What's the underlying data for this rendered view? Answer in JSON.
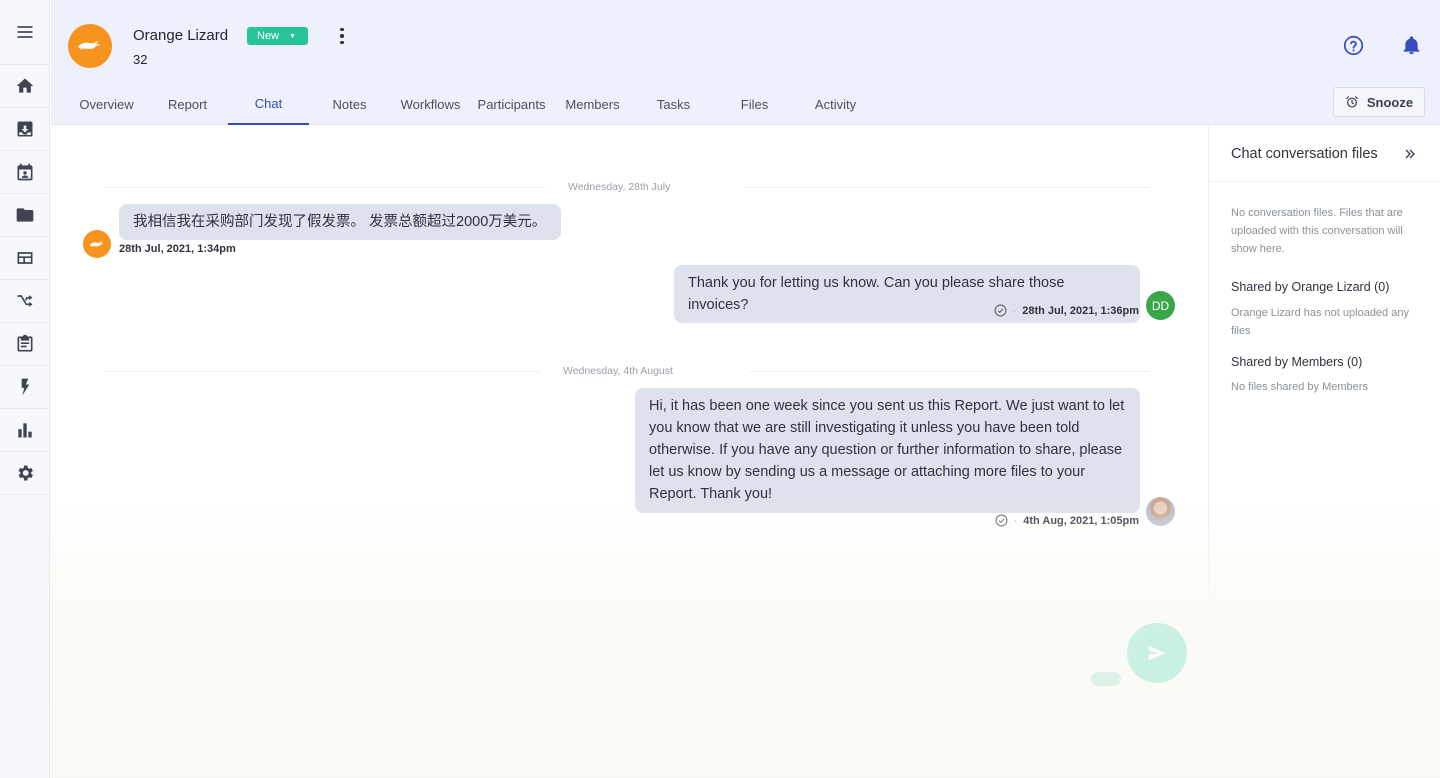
{
  "sidebar": {
    "items": [
      {
        "name": "menu-icon"
      },
      {
        "name": "home-icon"
      },
      {
        "name": "inbox-icon"
      },
      {
        "name": "calendar-icon"
      },
      {
        "name": "folder-icon"
      },
      {
        "name": "dashboard-icon"
      },
      {
        "name": "shuffle-icon"
      },
      {
        "name": "clipboard-icon"
      },
      {
        "name": "lightning-icon"
      },
      {
        "name": "bar-chart-icon"
      },
      {
        "name": "gear-icon"
      }
    ]
  },
  "header": {
    "org_name": "Orange Lizard",
    "org_number": "32",
    "status": "New",
    "snooze_label": "Snooze"
  },
  "tabs": [
    "Overview",
    "Report",
    "Chat",
    "Notes",
    "Workflows",
    "Participants",
    "Members",
    "Tasks",
    "Files",
    "Activity"
  ],
  "active_tab": "Chat",
  "chat": {
    "date1": "Wednesday, 28th July",
    "msg1": {
      "text": "我相信我在采购部门发现了假发票。 发票总额超过2000万美元。",
      "time": "28th Jul, 2021, 1:34pm"
    },
    "msg2": {
      "text": "Thank you for letting us know. Can you please share those invoices?",
      "time": "28th Jul, 2021, 1:36pm",
      "avatar": "DD"
    },
    "date2": "Wednesday, 4th August",
    "msg3": {
      "text": "Hi, it has been one week since you sent us this Report. We just want to let you know that we are still investigating it unless you have been told otherwise. If you have any question or further information to share, please let us know by sending us a message or attaching more files to your Report. Thank you!",
      "time": "4th Aug, 2021, 1:05pm"
    },
    "dot": "·"
  },
  "files_panel": {
    "title": "Chat conversation files",
    "empty_note": "No conversation files. Files that are uploaded with this conversation will show here.",
    "shared_by_org": "Shared by Orange Lizard (0)",
    "org_note": "Orange Lizard has not uploaded any files",
    "shared_by_members": "Shared by Members (0)",
    "members_note": "No files shared by Members"
  },
  "colors": {
    "accent": "#3a4bbf",
    "brand_orange": "#f7941d",
    "status_green": "#27c499",
    "avatar_green": "#3aa64a"
  }
}
